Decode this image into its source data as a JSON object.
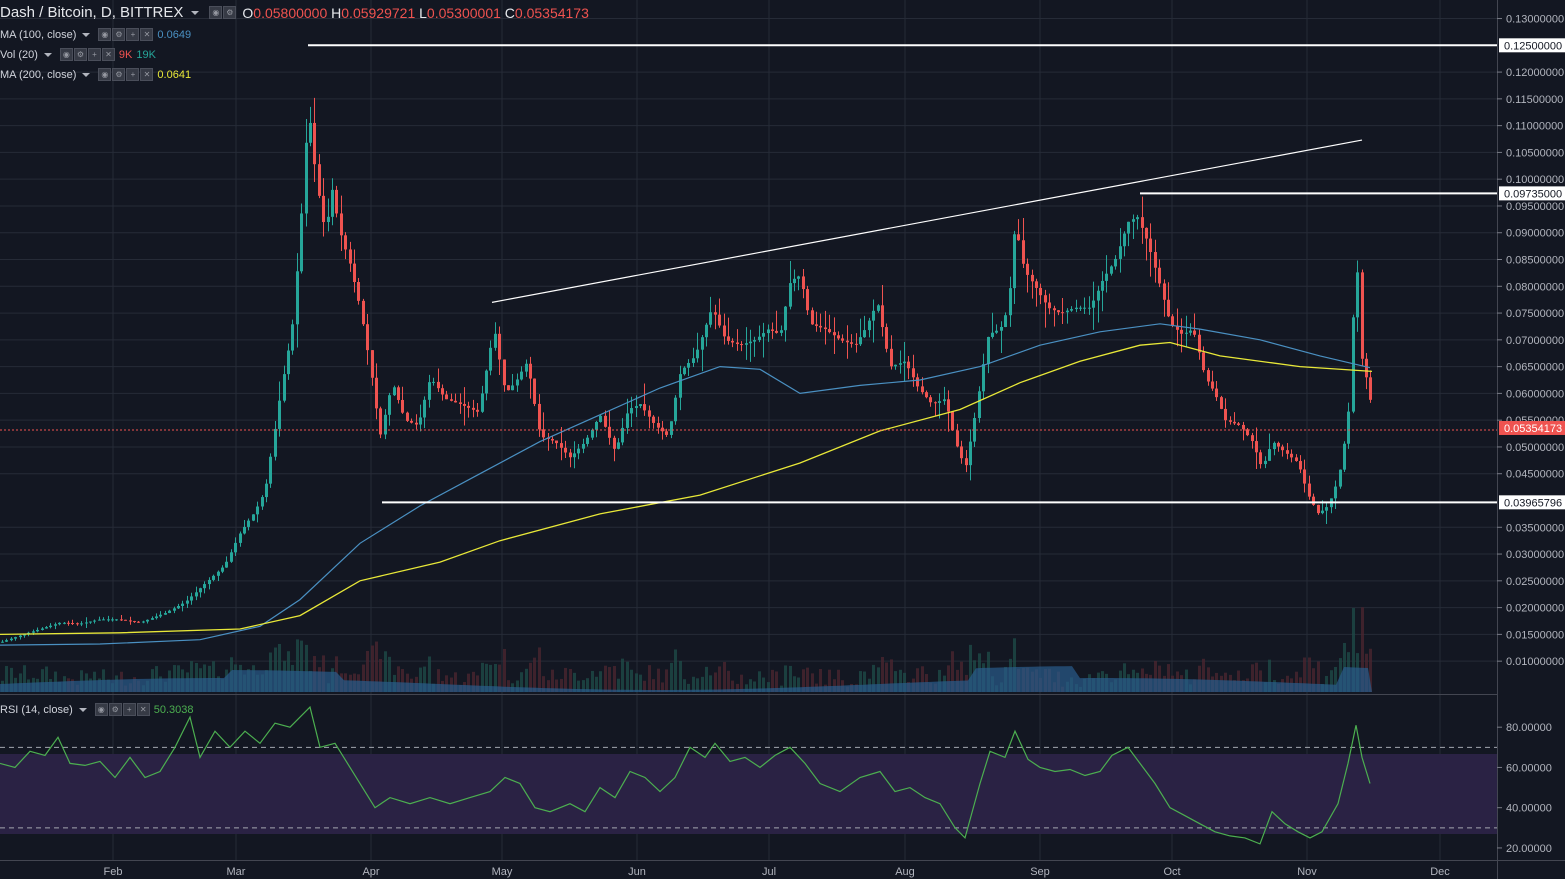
{
  "header": {
    "symbol": "Dash / Bitcoin, D, BITTREX",
    "open_label": "O",
    "open": "0.05800000",
    "high_label": "H",
    "high": "0.05929721",
    "low_label": "L",
    "low": "0.05300001",
    "close_label": "C",
    "close": "0.05354173"
  },
  "indicators": [
    {
      "label": "MA (100, close)",
      "value": "0.0649",
      "color": "#4a90c2"
    },
    {
      "label": "Vol (20)",
      "value_a": "9K",
      "value_b": "19K",
      "color_a": "#ef5350",
      "color_b": "#26a69a"
    },
    {
      "label": "MA (200, close)",
      "value": "0.0641",
      "color": "#e8e838"
    }
  ],
  "rsi": {
    "label": "RSI (14, close)",
    "value": "50.3038",
    "color": "#4caf50"
  },
  "chart_data": {
    "type": "candlestick",
    "price_axis": {
      "ticks": [
        "0.13000000",
        "0.12000000",
        "0.11500000",
        "0.11000000",
        "0.10500000",
        "0.10000000",
        "0.09500000",
        "0.09000000",
        "0.08500000",
        "0.08000000",
        "0.07500000",
        "0.07000000",
        "0.06500000",
        "0.06000000",
        "0.05500000",
        "0.05000000",
        "0.04500000",
        "0.03500000",
        "0.03000000",
        "0.02500000",
        "0.02000000",
        "0.01500000",
        "0.01000000"
      ],
      "ylim": [
        0.0048,
        0.1329
      ],
      "level_labels": [
        "0.12500000",
        "0.09735000",
        "0.03965796"
      ],
      "current_label": "0.05354173"
    },
    "rsi_axis": {
      "ticks": [
        "80.00000",
        "60.00000",
        "40.00000",
        "20.00000"
      ],
      "ylim": [
        15,
        95
      ],
      "bands": [
        70,
        30
      ]
    },
    "months": [
      "Feb",
      "Mar",
      "Apr",
      "May",
      "Jun",
      "Jul",
      "Aug",
      "Sep",
      "Oct",
      "Nov",
      "Dec"
    ],
    "price_path": [
      [
        0,
        0.0135
      ],
      [
        20,
        0.0148
      ],
      [
        40,
        0.016
      ],
      [
        60,
        0.0172
      ],
      [
        80,
        0.017
      ],
      [
        100,
        0.0178
      ],
      [
        118,
        0.0178
      ],
      [
        140,
        0.0172
      ],
      [
        165,
        0.019
      ],
      [
        185,
        0.021
      ],
      [
        205,
        0.0245
      ],
      [
        225,
        0.028
      ],
      [
        240,
        0.034
      ],
      [
        255,
        0.038
      ],
      [
        265,
        0.042
      ],
      [
        272,
        0.05
      ],
      [
        282,
        0.062
      ],
      [
        292,
        0.072
      ],
      [
        300,
        0.09
      ],
      [
        308,
        0.114
      ],
      [
        316,
        0.1
      ],
      [
        325,
        0.09
      ],
      [
        332,
        0.098
      ],
      [
        340,
        0.09
      ],
      [
        350,
        0.084
      ],
      [
        360,
        0.076
      ],
      [
        370,
        0.065
      ],
      [
        380,
        0.052
      ],
      [
        392,
        0.062
      ],
      [
        405,
        0.055
      ],
      [
        418,
        0.054
      ],
      [
        430,
        0.063
      ],
      [
        445,
        0.059
      ],
      [
        460,
        0.058
      ],
      [
        478,
        0.0565
      ],
      [
        494,
        0.072
      ],
      [
        505,
        0.06
      ],
      [
        515,
        0.062
      ],
      [
        527,
        0.066
      ],
      [
        540,
        0.052
      ],
      [
        555,
        0.051
      ],
      [
        570,
        0.048
      ],
      [
        585,
        0.051
      ],
      [
        600,
        0.056
      ],
      [
        615,
        0.049
      ],
      [
        628,
        0.057
      ],
      [
        640,
        0.058
      ],
      [
        655,
        0.054
      ],
      [
        668,
        0.052
      ],
      [
        680,
        0.064
      ],
      [
        695,
        0.067
      ],
      [
        712,
        0.076
      ],
      [
        725,
        0.07
      ],
      [
        740,
        0.069
      ],
      [
        755,
        0.07
      ],
      [
        768,
        0.072
      ],
      [
        780,
        0.071
      ],
      [
        790,
        0.081
      ],
      [
        800,
        0.082
      ],
      [
        810,
        0.073
      ],
      [
        825,
        0.072
      ],
      [
        840,
        0.07
      ],
      [
        855,
        0.069
      ],
      [
        865,
        0.072
      ],
      [
        877,
        0.077
      ],
      [
        890,
        0.065
      ],
      [
        905,
        0.066
      ],
      [
        918,
        0.061
      ],
      [
        932,
        0.058
      ],
      [
        945,
        0.059
      ],
      [
        955,
        0.051
      ],
      [
        965,
        0.046
      ],
      [
        975,
        0.056
      ],
      [
        988,
        0.071
      ],
      [
        1000,
        0.072
      ],
      [
        1008,
        0.076
      ],
      [
        1015,
        0.092
      ],
      [
        1024,
        0.083
      ],
      [
        1035,
        0.08
      ],
      [
        1048,
        0.076
      ],
      [
        1060,
        0.075
      ],
      [
        1075,
        0.076
      ],
      [
        1090,
        0.076
      ],
      [
        1102,
        0.081
      ],
      [
        1115,
        0.085
      ],
      [
        1128,
        0.092
      ],
      [
        1137,
        0.093
      ],
      [
        1148,
        0.088
      ],
      [
        1160,
        0.08
      ],
      [
        1170,
        0.073
      ],
      [
        1182,
        0.071
      ],
      [
        1193,
        0.072
      ],
      [
        1205,
        0.063
      ],
      [
        1215,
        0.06
      ],
      [
        1225,
        0.055
      ],
      [
        1240,
        0.054
      ],
      [
        1252,
        0.051
      ],
      [
        1262,
        0.046
      ],
      [
        1272,
        0.051
      ],
      [
        1285,
        0.049
      ],
      [
        1298,
        0.047
      ],
      [
        1308,
        0.041
      ],
      [
        1318,
        0.0375
      ],
      [
        1328,
        0.039
      ],
      [
        1338,
        0.044
      ],
      [
        1348,
        0.055
      ],
      [
        1356,
        0.087
      ],
      [
        1362,
        0.065
      ],
      [
        1368,
        0.062
      ],
      [
        1374,
        0.054
      ]
    ],
    "ma100_path": [
      [
        0,
        0.013
      ],
      [
        100,
        0.0132
      ],
      [
        200,
        0.014
      ],
      [
        260,
        0.0165
      ],
      [
        300,
        0.0215
      ],
      [
        360,
        0.032
      ],
      [
        420,
        0.039
      ],
      [
        480,
        0.045
      ],
      [
        540,
        0.051
      ],
      [
        600,
        0.056
      ],
      [
        660,
        0.061
      ],
      [
        720,
        0.065
      ],
      [
        760,
        0.0645
      ],
      [
        800,
        0.06
      ],
      [
        860,
        0.0615
      ],
      [
        920,
        0.0625
      ],
      [
        980,
        0.065
      ],
      [
        1040,
        0.069
      ],
      [
        1100,
        0.0715
      ],
      [
        1160,
        0.073
      ],
      [
        1200,
        0.072
      ],
      [
        1260,
        0.07
      ],
      [
        1320,
        0.067
      ],
      [
        1370,
        0.0648
      ]
    ],
    "ma200_path": [
      [
        0,
        0.015
      ],
      [
        120,
        0.0153
      ],
      [
        240,
        0.016
      ],
      [
        300,
        0.0185
      ],
      [
        360,
        0.025
      ],
      [
        440,
        0.0285
      ],
      [
        500,
        0.0325
      ],
      [
        600,
        0.0375
      ],
      [
        700,
        0.041
      ],
      [
        800,
        0.047
      ],
      [
        880,
        0.053
      ],
      [
        960,
        0.057
      ],
      [
        1020,
        0.062
      ],
      [
        1080,
        0.066
      ],
      [
        1140,
        0.069
      ],
      [
        1170,
        0.0695
      ],
      [
        1220,
        0.067
      ],
      [
        1300,
        0.065
      ],
      [
        1372,
        0.0641
      ]
    ],
    "rsi_path": [
      [
        0,
        62
      ],
      [
        15,
        60
      ],
      [
        30,
        68
      ],
      [
        45,
        66
      ],
      [
        58,
        75
      ],
      [
        70,
        62
      ],
      [
        85,
        61
      ],
      [
        100,
        63
      ],
      [
        115,
        55
      ],
      [
        130,
        65
      ],
      [
        145,
        55
      ],
      [
        160,
        58
      ],
      [
        175,
        70
      ],
      [
        190,
        85
      ],
      [
        200,
        65
      ],
      [
        215,
        78
      ],
      [
        230,
        70
      ],
      [
        245,
        78
      ],
      [
        260,
        72
      ],
      [
        275,
        82
      ],
      [
        290,
        80
      ],
      [
        310,
        90
      ],
      [
        320,
        70
      ],
      [
        335,
        72
      ],
      [
        350,
        60
      ],
      [
        365,
        48
      ],
      [
        375,
        40
      ],
      [
        390,
        45
      ],
      [
        410,
        42
      ],
      [
        430,
        45
      ],
      [
        450,
        42
      ],
      [
        470,
        45
      ],
      [
        490,
        48
      ],
      [
        505,
        55
      ],
      [
        520,
        52
      ],
      [
        535,
        40
      ],
      [
        550,
        38
      ],
      [
        570,
        42
      ],
      [
        585,
        38
      ],
      [
        600,
        50
      ],
      [
        615,
        45
      ],
      [
        630,
        58
      ],
      [
        645,
        55
      ],
      [
        660,
        48
      ],
      [
        675,
        55
      ],
      [
        690,
        70
      ],
      [
        705,
        65
      ],
      [
        715,
        72
      ],
      [
        730,
        63
      ],
      [
        745,
        65
      ],
      [
        760,
        60
      ],
      [
        775,
        66
      ],
      [
        790,
        70
      ],
      [
        805,
        62
      ],
      [
        820,
        52
      ],
      [
        840,
        48
      ],
      [
        860,
        55
      ],
      [
        880,
        58
      ],
      [
        895,
        48
      ],
      [
        910,
        50
      ],
      [
        925,
        45
      ],
      [
        940,
        42
      ],
      [
        955,
        30
      ],
      [
        965,
        25
      ],
      [
        980,
        52
      ],
      [
        990,
        68
      ],
      [
        1005,
        65
      ],
      [
        1015,
        78
      ],
      [
        1028,
        64
      ],
      [
        1040,
        60
      ],
      [
        1055,
        58
      ],
      [
        1070,
        59
      ],
      [
        1085,
        56
      ],
      [
        1100,
        58
      ],
      [
        1112,
        66
      ],
      [
        1128,
        70
      ],
      [
        1140,
        62
      ],
      [
        1155,
        52
      ],
      [
        1170,
        40
      ],
      [
        1185,
        36
      ],
      [
        1200,
        32
      ],
      [
        1215,
        28
      ],
      [
        1230,
        26
      ],
      [
        1245,
        25
      ],
      [
        1260,
        22
      ],
      [
        1272,
        38
      ],
      [
        1285,
        32
      ],
      [
        1298,
        28
      ],
      [
        1310,
        25
      ],
      [
        1322,
        28
      ],
      [
        1338,
        42
      ],
      [
        1348,
        62
      ],
      [
        1356,
        81
      ],
      [
        1362,
        65
      ],
      [
        1370,
        52
      ]
    ],
    "levels": [
      0.125,
      0.09735,
      0.03965796
    ],
    "trendline": [
      [
        492,
        0.077
      ],
      [
        1362,
        0.1073
      ]
    ]
  }
}
